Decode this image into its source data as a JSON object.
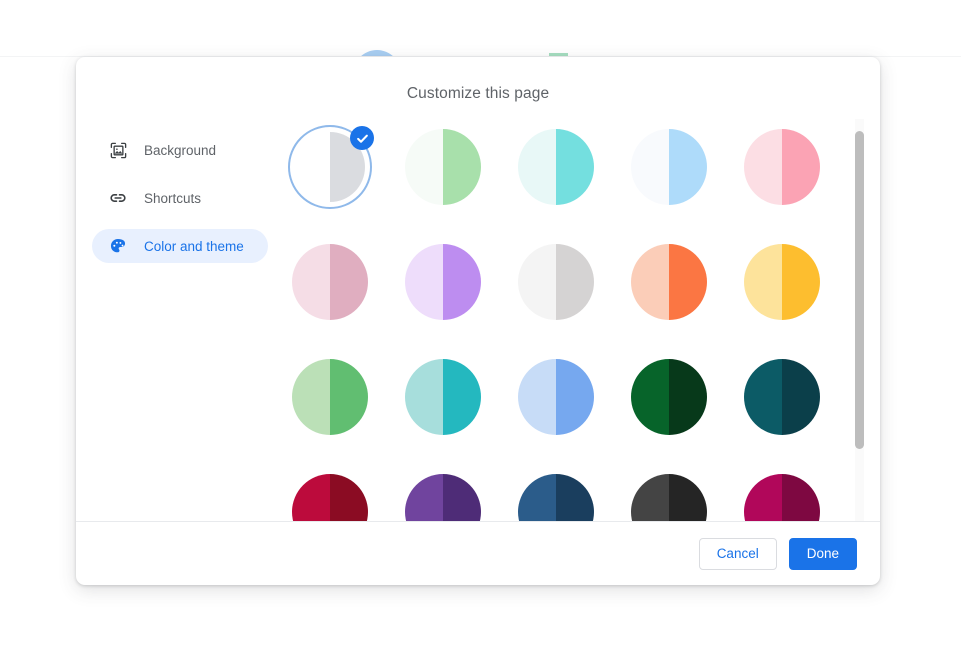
{
  "dialog": {
    "title": "Customize this page"
  },
  "sidebar": {
    "items": [
      {
        "id": "background",
        "label": "Background",
        "icon": "image-icon",
        "active": false
      },
      {
        "id": "shortcuts",
        "label": "Shortcuts",
        "icon": "link-icon",
        "active": false
      },
      {
        "id": "color-and-theme",
        "label": "Color and theme",
        "icon": "palette-icon",
        "active": true
      }
    ]
  },
  "footer": {
    "cancel_label": "Cancel",
    "done_label": "Done"
  },
  "colors": {
    "accent": "#1a73e8",
    "selected_ring": "#8fb9ea",
    "active_nav_bg": "#e8f0fe",
    "title_text": "#5f6368",
    "divider": "#e8eaed",
    "scrollbar_thumb": "#bdbdbd"
  },
  "theme_grid": {
    "columns": 5,
    "selected_index": 0,
    "swatches": [
      {
        "name": "default-white",
        "light": "#ffffff",
        "dark": "#dadce0",
        "selected": true
      },
      {
        "name": "mint-green",
        "light": "#f6fbf7",
        "dark": "#a8e0ab",
        "selected": false
      },
      {
        "name": "aqua-turquoise",
        "light": "#e8f8f7",
        "dark": "#74dfdf",
        "selected": false
      },
      {
        "name": "sky-blue",
        "light": "#f8fafd",
        "dark": "#aedbfa",
        "selected": false
      },
      {
        "name": "blush-pink",
        "light": "#fcdee4",
        "dark": "#fba3b4",
        "selected": false
      },
      {
        "name": "dusty-rose",
        "light": "#f5dde6",
        "dark": "#e0aec0",
        "selected": false
      },
      {
        "name": "lavender",
        "light": "#eeddfb",
        "dark": "#bd8df0",
        "selected": false
      },
      {
        "name": "light-grey",
        "light": "#f4f4f4",
        "dark": "#d5d3d3",
        "selected": false
      },
      {
        "name": "coral-orange",
        "light": "#fbcdb8",
        "dark": "#fb7643",
        "selected": false
      },
      {
        "name": "amber-yellow",
        "light": "#fde39b",
        "dark": "#fdbe2f",
        "selected": false
      },
      {
        "name": "sage-green",
        "light": "#bbe0b7",
        "dark": "#61be71",
        "selected": false
      },
      {
        "name": "teal-cyan",
        "light": "#a7dedc",
        "dark": "#24b8bf",
        "selected": false
      },
      {
        "name": "cornflower-blue",
        "light": "#c7dcf7",
        "dark": "#76a8ef",
        "selected": false
      },
      {
        "name": "forest-green",
        "light": "#07642a",
        "dark": "#07391a",
        "selected": false
      },
      {
        "name": "deep-teal",
        "light": "#0c5b66",
        "dark": "#0b3f4a",
        "selected": false
      },
      {
        "name": "crimson-red",
        "light": "#bc0b3c",
        "dark": "#8b0c23",
        "selected": false
      },
      {
        "name": "royal-purple",
        "light": "#70449e",
        "dark": "#4e2c77",
        "selected": false
      },
      {
        "name": "navy-blue",
        "light": "#2b5c8a",
        "dark": "#1a3e5e",
        "selected": false
      },
      {
        "name": "charcoal-grey",
        "light": "#444444",
        "dark": "#252525",
        "selected": false
      },
      {
        "name": "magenta-plum",
        "light": "#b1075a",
        "dark": "#7e0841",
        "selected": false
      }
    ]
  }
}
